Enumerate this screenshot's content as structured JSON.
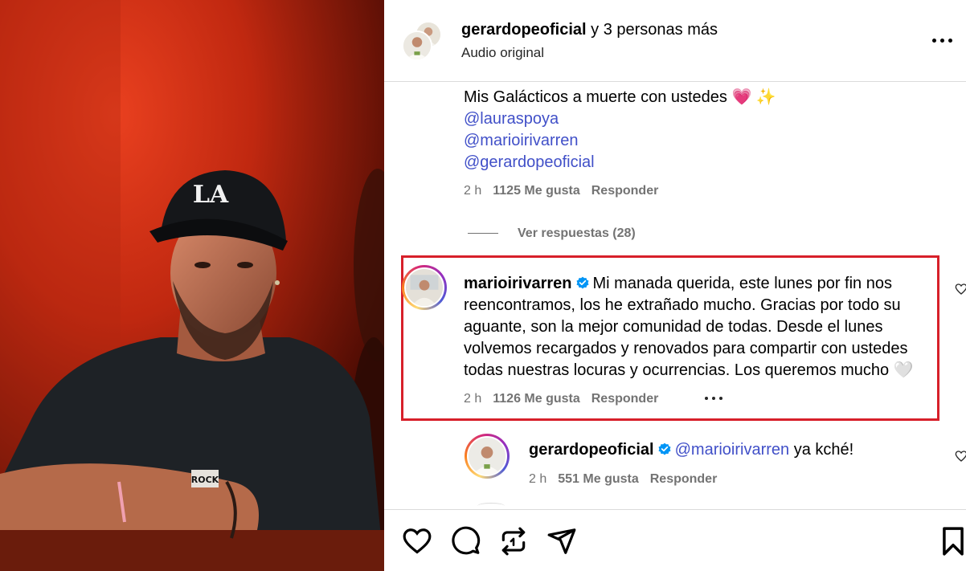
{
  "header": {
    "username": "gerardopeoficial",
    "suffix": " y 3 personas más",
    "subtitle": "Audio original"
  },
  "caption": {
    "text": "Mis Galácticos a muerte con ustedes 💗 ✨",
    "mentions": [
      "@lauraspoya",
      "@marioirivarren",
      "@gerardopeoficial"
    ],
    "time": "2 h",
    "likes": "1125 Me gusta",
    "reply_label": "Responder"
  },
  "view_replies": "Ver respuestas (28)",
  "highlighted_comment": {
    "username": "marioirivarren",
    "text": "Mi manada querida, este lunes por fin nos reencontramos, los he extrañado mucho. Gracias por todo su aguante, son la mejor comunidad de todas. Desde el lunes volvemos recargados y renovados para compartir con ustedes todas nuestras locuras y ocurrencias. Los queremos mucho 🤍",
    "time": "2 h",
    "likes": "1126 Me gusta",
    "reply_label": "Responder"
  },
  "reply_comment": {
    "username": "gerardopeoficial",
    "mention": "@marioirivarren",
    "text": " ya kché!",
    "time": "2 h",
    "likes": "551 Me gusta",
    "reply_label": "Responder"
  },
  "photo_texts": {
    "cap_logo": "LA",
    "shirt_tag": "ROCK"
  },
  "colors": {
    "mention": "#4150c8",
    "highlight_border": "#d7202a",
    "verified": "#0095f6",
    "meta": "#737373"
  }
}
